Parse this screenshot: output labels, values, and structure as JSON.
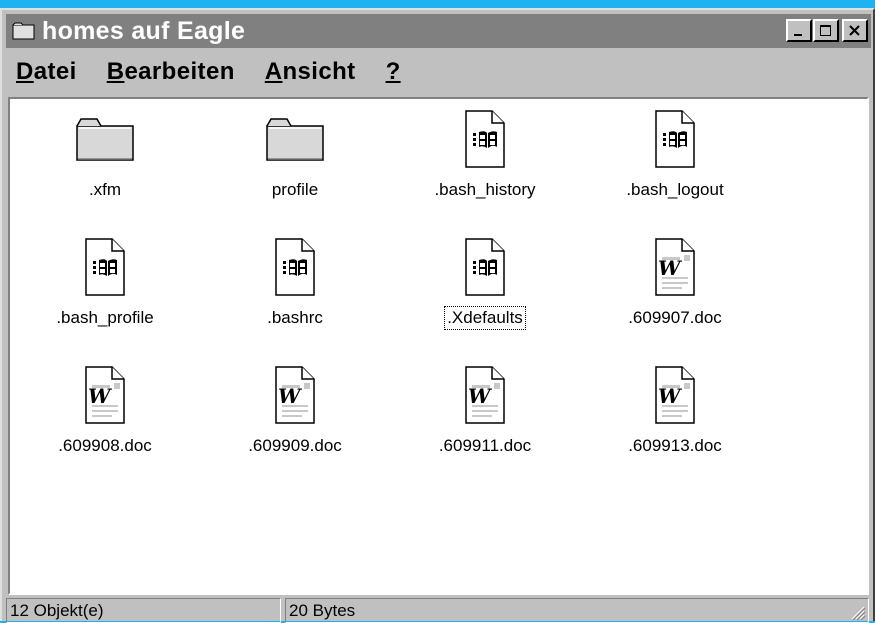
{
  "window": {
    "title": "homes auf Eagle",
    "title_icon": "folder-icon",
    "buttons": [
      "minimize-icon",
      "maximize-icon",
      "close-icon"
    ]
  },
  "menu": {
    "items": [
      {
        "accel": "D",
        "rest": "atei"
      },
      {
        "accel": "B",
        "rest": "earbeiten"
      },
      {
        "accel": "A",
        "rest": "nsicht"
      },
      {
        "accel": "?",
        "rest": ""
      }
    ]
  },
  "files": [
    {
      "name": ".xfm",
      "icon": "folder"
    },
    {
      "name": "profile",
      "icon": "folder"
    },
    {
      "name": ".bash_history",
      "icon": "windows-file"
    },
    {
      "name": ".bash_logout",
      "icon": "windows-file"
    },
    {
      "name": ".bash_profile",
      "icon": "windows-file"
    },
    {
      "name": ".bashrc",
      "icon": "windows-file"
    },
    {
      "name": ".Xdefaults",
      "icon": "windows-file",
      "focused": true
    },
    {
      "name": ".609907.doc",
      "icon": "word-doc"
    },
    {
      "name": ".609908.doc",
      "icon": "word-doc"
    },
    {
      "name": ".609909.doc",
      "icon": "word-doc"
    },
    {
      "name": ".609911.doc",
      "icon": "word-doc"
    },
    {
      "name": ".609913.doc",
      "icon": "word-doc"
    }
  ],
  "status": {
    "objects": "12 Objekt(e)",
    "size": "20 Bytes"
  },
  "colors": {
    "desktop": "#1fb2f0",
    "titlebar_inactive": "#808080",
    "face": "#c0c0c0"
  }
}
